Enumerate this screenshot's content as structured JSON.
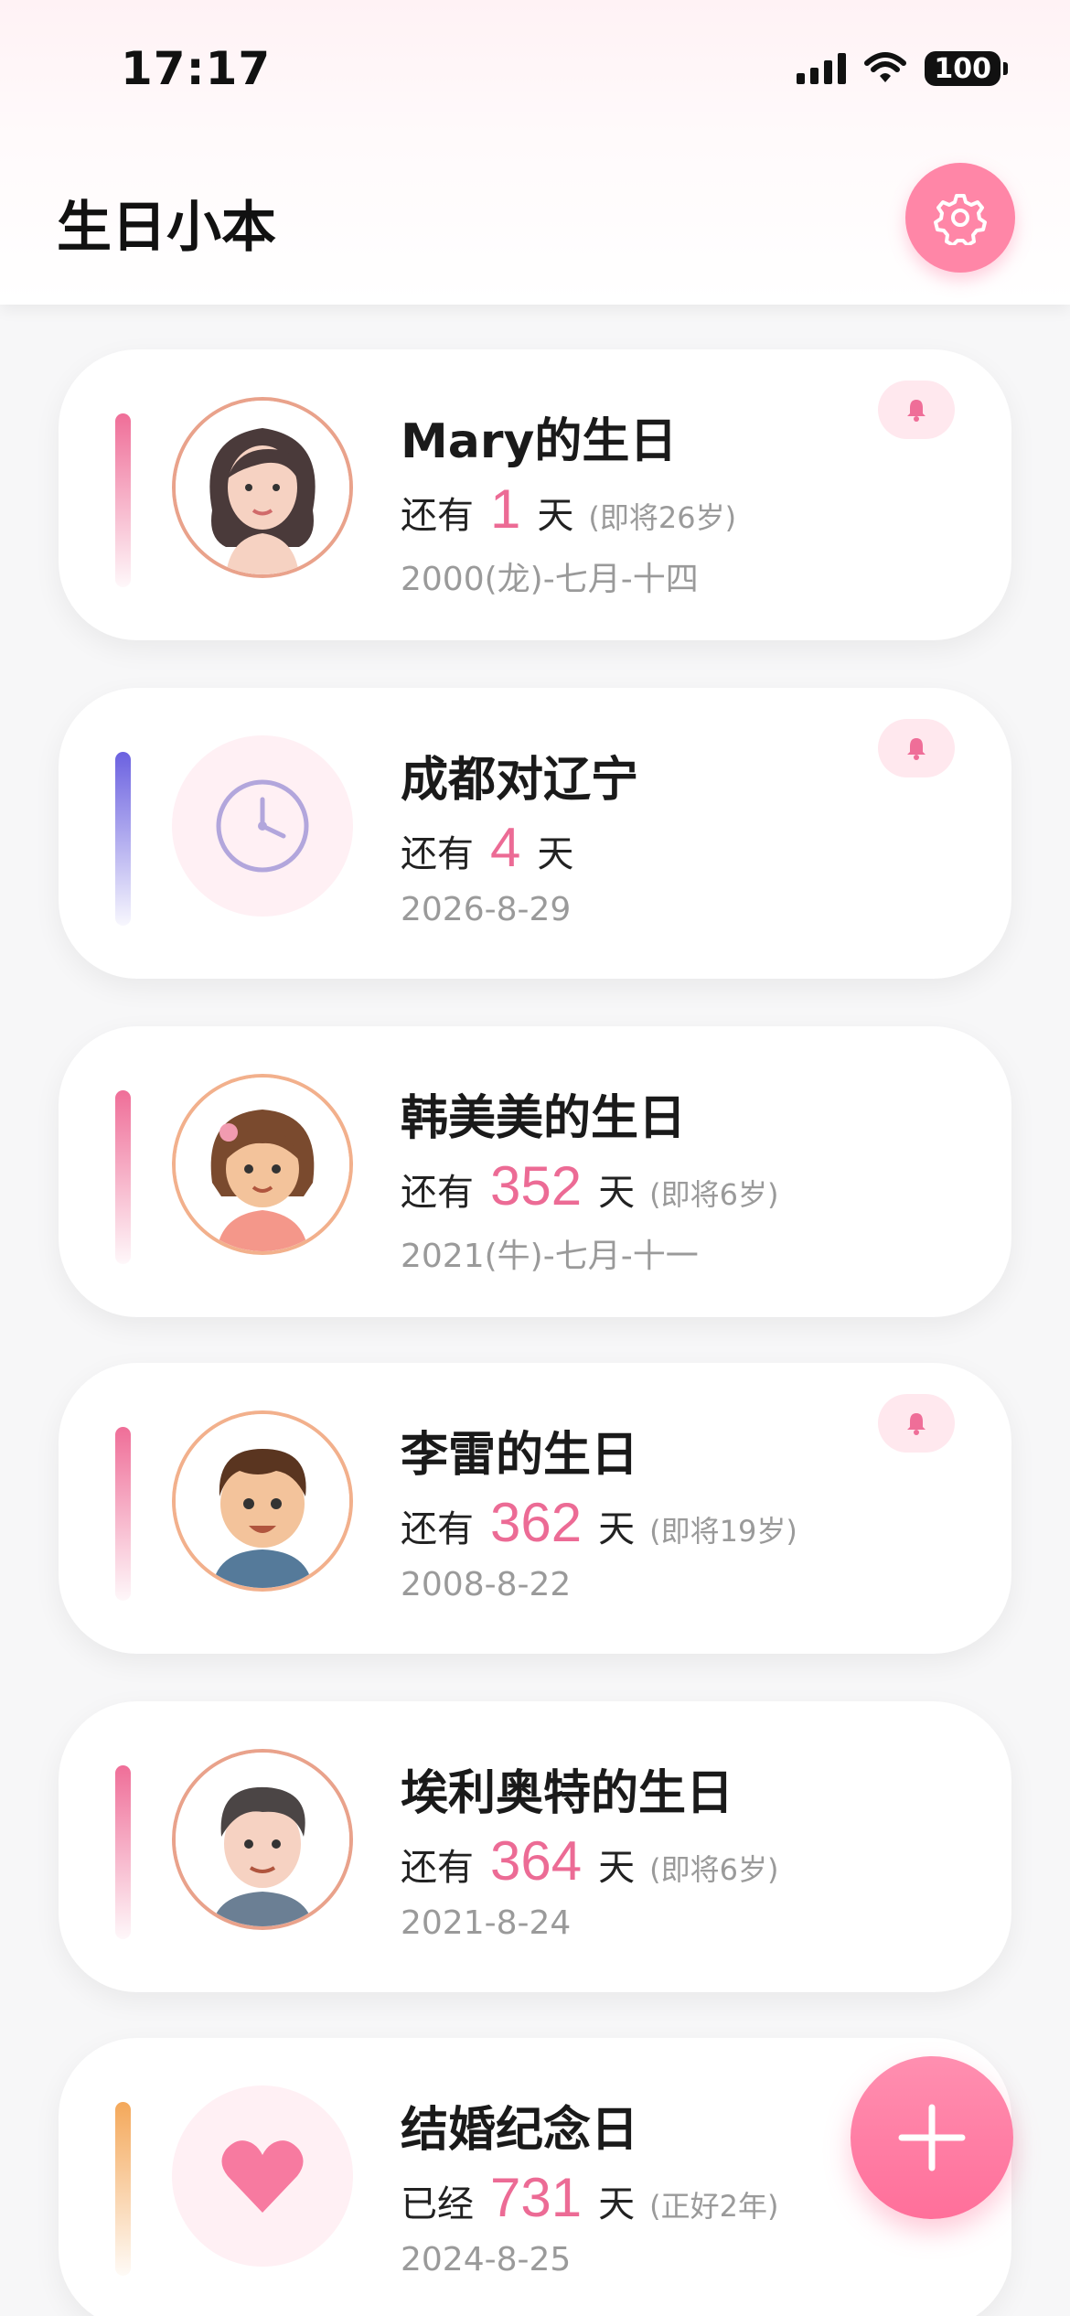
{
  "status_bar": {
    "time": "17:17",
    "battery": "100"
  },
  "header": {
    "title": "生日小本",
    "settings_icon": "gear-icon"
  },
  "colors": {
    "accent_pink": "#ec6b95",
    "fab_pink": "#ff7ea3",
    "purple": "#7a70e6",
    "orange": "#f4a85a"
  },
  "cards": [
    {
      "title": "Mary的生日",
      "prefix": "还有",
      "number": "1",
      "unit": "天",
      "note": "(即将26岁)",
      "date": "2000(龙)-七月-十四",
      "has_bell": true,
      "accent": "pink",
      "icon": "woman-avatar"
    },
    {
      "title": "成都对辽宁",
      "prefix": "还有",
      "number": "4",
      "unit": "天",
      "note": "",
      "date": "2026-8-29",
      "has_bell": true,
      "accent": "purple",
      "icon": "clock-icon"
    },
    {
      "title": "韩美美的生日",
      "prefix": "还有",
      "number": "352",
      "unit": "天",
      "note": "(即将6岁)",
      "date": "2021(牛)-七月-十一",
      "has_bell": false,
      "accent": "pink",
      "icon": "girl-avatar"
    },
    {
      "title": "李雷的生日",
      "prefix": "还有",
      "number": "362",
      "unit": "天",
      "note": "(即将19岁)",
      "date": "2008-8-22",
      "has_bell": true,
      "accent": "pink",
      "icon": "boy-avatar"
    },
    {
      "title": "埃利奥特的生日",
      "prefix": "还有",
      "number": "364",
      "unit": "天",
      "note": "(即将6岁)",
      "date": "2021-8-24",
      "has_bell": false,
      "accent": "pink",
      "icon": "man-avatar"
    },
    {
      "title": "结婚纪念日",
      "prefix": "已经",
      "number": "731",
      "unit": "天",
      "note": "(正好2年)",
      "date": "2024-8-25",
      "has_bell": false,
      "accent": "orange",
      "icon": "heart-icon"
    }
  ],
  "fab": {
    "icon": "plus-icon"
  }
}
